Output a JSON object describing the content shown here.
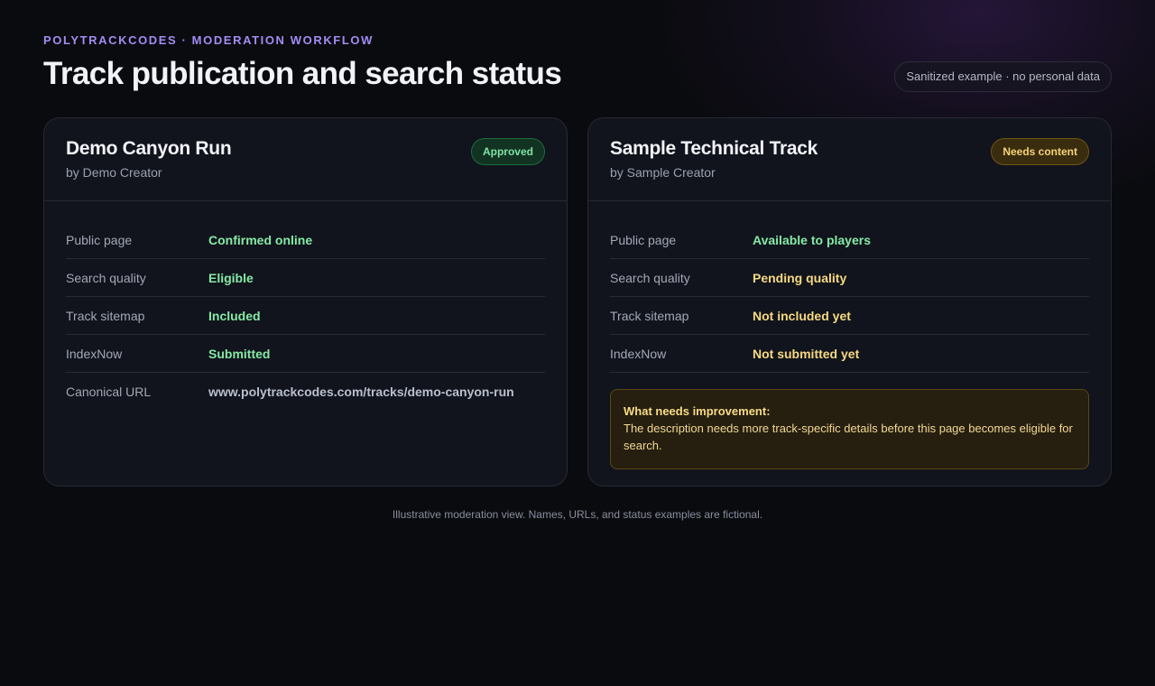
{
  "header": {
    "eyebrow": "POLYTRACKCODES · MODERATION WORKFLOW",
    "title": "Track publication and search status",
    "notice": "Sanitized example · no personal data"
  },
  "cards": [
    {
      "title": "Demo Canyon Run",
      "author": "by Demo Creator",
      "badge": "Approved",
      "rows": [
        {
          "label": "Public page",
          "value": "Confirmed online"
        },
        {
          "label": "Search quality",
          "value": "Eligible"
        },
        {
          "label": "Track sitemap",
          "value": "Included"
        },
        {
          "label": "IndexNow",
          "value": "Submitted"
        },
        {
          "label": "Canonical URL",
          "value": "www.polytrackcodes.com/tracks/demo-canyon-run"
        }
      ]
    },
    {
      "title": "Sample Technical Track",
      "author": "by Sample Creator",
      "badge": "Needs content",
      "rows": [
        {
          "label": "Public page",
          "value": "Available to players"
        },
        {
          "label": "Search quality",
          "value": "Pending quality"
        },
        {
          "label": "Track sitemap",
          "value": "Not included yet"
        },
        {
          "label": "IndexNow",
          "value": "Not submitted yet"
        }
      ],
      "improvement": {
        "title": "What needs improvement:",
        "text": "The description needs more track-specific details before this page becomes eligible for search."
      }
    }
  ],
  "footnote": "Illustrative moderation view. Names, URLs, and status examples are fictional.",
  "colors": {
    "accent": "#a58bf3",
    "success": "#86e9a6",
    "warning": "#f7d982",
    "background": "#0a0b0f",
    "card": "#11141c"
  }
}
